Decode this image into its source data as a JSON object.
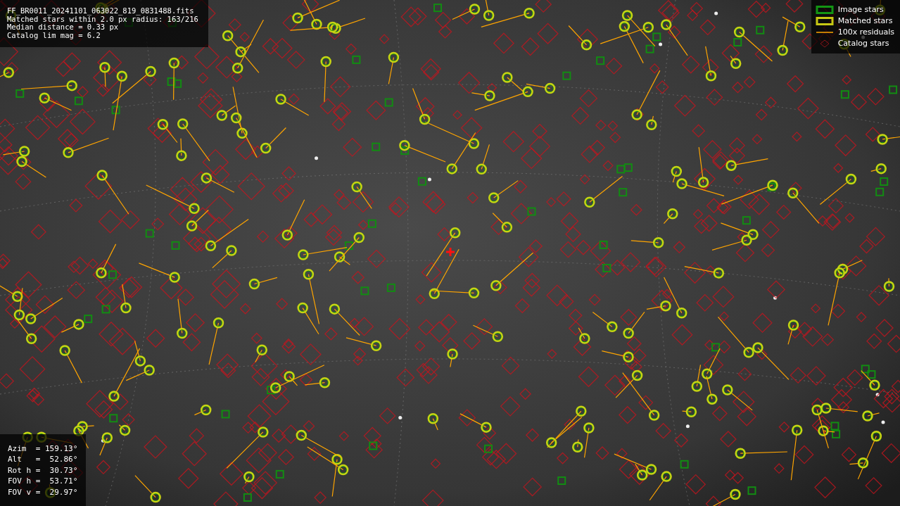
{
  "info_box": {
    "lines": [
      "FF_BR0011_20241101_063022_819_0831488.fits",
      "Matched stars within 2.0 px radius: 163/216",
      "Median distance = 0.33 px",
      "Catalog lim mag = 6.2"
    ]
  },
  "legend": [
    {
      "kind": "image",
      "label": "Image stars"
    },
    {
      "kind": "matched",
      "label": "Matched stars"
    },
    {
      "kind": "residual",
      "label": "100x residuals"
    },
    {
      "kind": "catalog",
      "label": "Catalog stars"
    }
  ],
  "pointing_box": {
    "lines": [
      "Azim  = 159.13°",
      "Alt   =  52.86°",
      "Rot h =  30.73°",
      "FOV h =  53.71°",
      "FOV v =  29.97°"
    ]
  }
}
